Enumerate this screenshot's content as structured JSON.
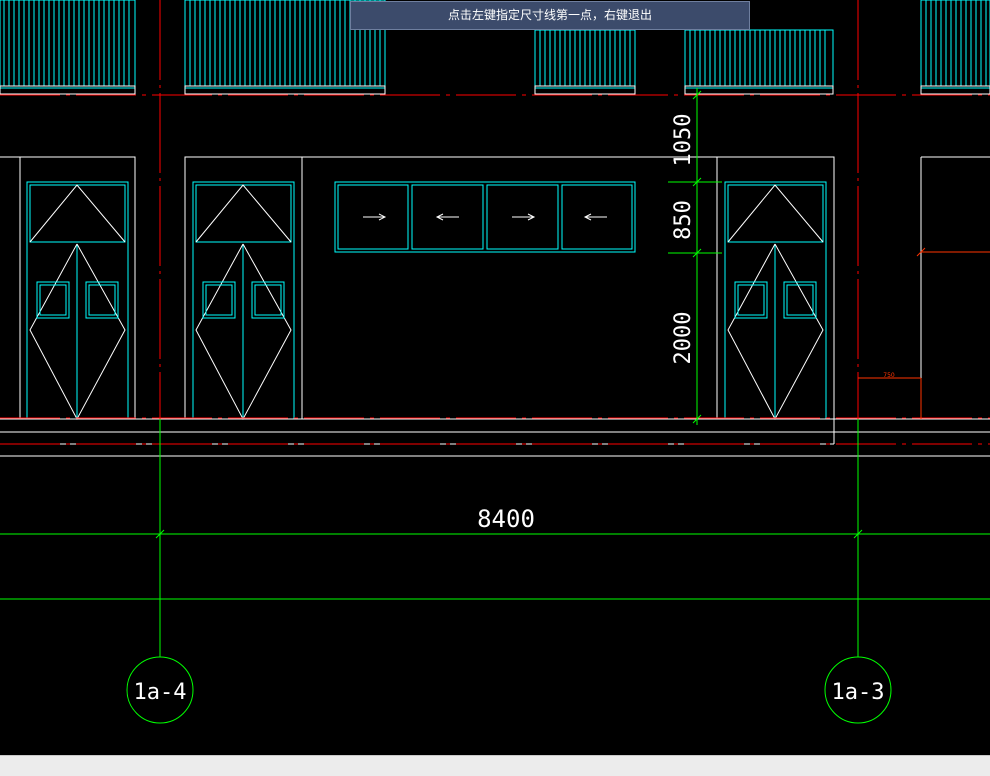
{
  "prompt": {
    "text": "点击左键指定尺寸线第一点，右键退出"
  },
  "dimensions": {
    "horizontal_total": "8400",
    "vertical_top": "1050",
    "vertical_middle": "850",
    "vertical_bottom": "2000",
    "small_offset": "750"
  },
  "axes": {
    "left_label": "1a-4",
    "right_label": "1a-3"
  },
  "colors": {
    "background": "#000000",
    "wall_line": "#ffffff",
    "window_frame": "#00ffff",
    "axis_line": "#ff0000",
    "dimension_line": "#00ff00",
    "annotation": "#ff3300",
    "prompt_bg": "#3c4b6b"
  }
}
